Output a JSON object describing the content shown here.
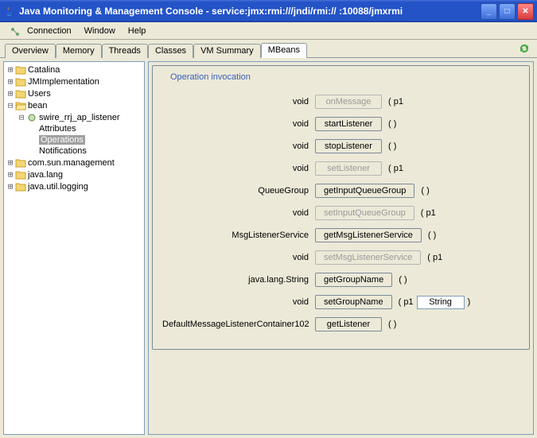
{
  "window": {
    "title": "Java Monitoring & Management Console - service:jmx:rmi:///jndi/rmi://                         :10088/jmxrmi"
  },
  "menu": {
    "connection": "Connection",
    "window": "Window",
    "help": "Help"
  },
  "tabs": {
    "overview": "Overview",
    "memory": "Memory",
    "threads": "Threads",
    "classes": "Classes",
    "vm": "VM Summary",
    "mbeans": "MBeans"
  },
  "tree": {
    "catalina": "Catalina",
    "jmimpl": "JMImplementation",
    "users": "Users",
    "bean": "bean",
    "swire": "swire_rrj_ap_listener",
    "attributes": "Attributes",
    "operations": "Operations",
    "notifications": "Notifications",
    "comsun": "com.sun.management",
    "javalang": "java.lang",
    "javautil": "java.util.logging"
  },
  "panel": {
    "title": "Operation invocation",
    "ops": [
      {
        "ret": "void",
        "name": "onMessage",
        "disabled": true,
        "params": "( p1"
      },
      {
        "ret": "void",
        "name": "startListener",
        "disabled": false,
        "params": "( )"
      },
      {
        "ret": "void",
        "name": "stopListener",
        "disabled": false,
        "params": "( )"
      },
      {
        "ret": "void",
        "name": "setListener",
        "disabled": true,
        "params": "( p1"
      },
      {
        "ret": "QueueGroup",
        "name": "getInputQueueGroup",
        "disabled": false,
        "params": "( )"
      },
      {
        "ret": "void",
        "name": "setInputQueueGroup",
        "disabled": true,
        "params": "( p1"
      },
      {
        "ret": "MsgListenerService",
        "name": "getMsgListenerService",
        "disabled": false,
        "params": "( )"
      },
      {
        "ret": "void",
        "name": "setMsgListenerService",
        "disabled": true,
        "params": "( p1"
      },
      {
        "ret": "java.lang.String",
        "name": "getGroupName",
        "disabled": false,
        "params": "( )"
      },
      {
        "ret": "void",
        "name": "setGroupName",
        "disabled": false,
        "params": "input",
        "input": "String"
      },
      {
        "ret": "DefaultMessageListenerContainer102",
        "name": "getListener",
        "disabled": false,
        "params": "( )"
      }
    ]
  }
}
